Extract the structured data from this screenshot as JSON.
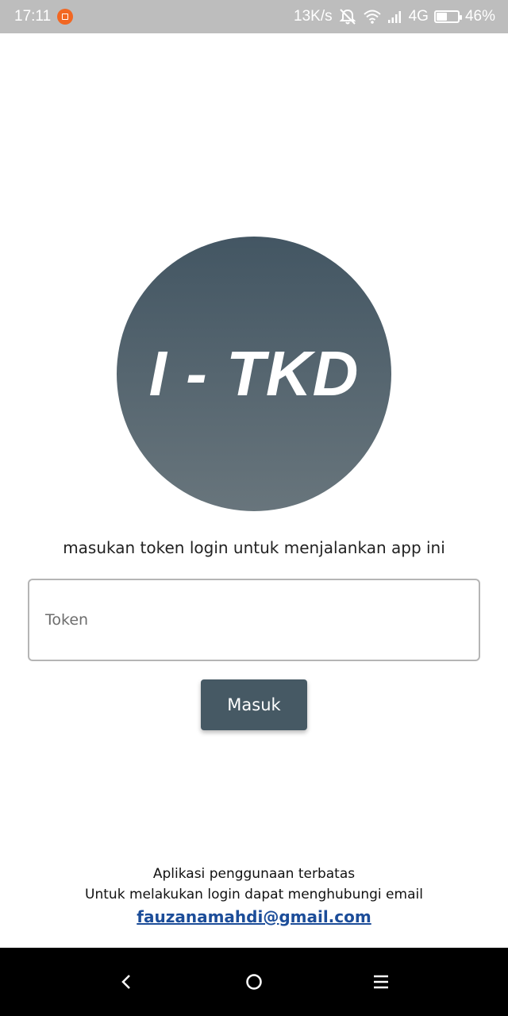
{
  "status_bar": {
    "time": "17:11",
    "network_speed": "13K/s",
    "network_type": "4G",
    "battery_percent": "46%",
    "battery_level": 0.46,
    "icons": [
      "notification-app-icon",
      "alarm-off-icon",
      "wifi-icon",
      "signal-icon",
      "battery-icon"
    ]
  },
  "logo": {
    "text": "I - TKD",
    "colors": {
      "top": "#435663",
      "bottom": "#68757c"
    }
  },
  "login": {
    "instruction": "masukan token login untuk menjalankan app ini",
    "token_value": "",
    "token_placeholder": "Token",
    "submit_label": "Masuk",
    "accent_color": "#465964"
  },
  "footer": {
    "line1": "Aplikasi penggunaan terbatas",
    "line2": "Untuk melakukan login dapat menghubungi email",
    "email": "fauzanamahdi@gmail.com",
    "email_color": "#1c4d99"
  },
  "nav_bar": {
    "icons": [
      "back-icon",
      "home-icon",
      "menu-icon"
    ]
  }
}
